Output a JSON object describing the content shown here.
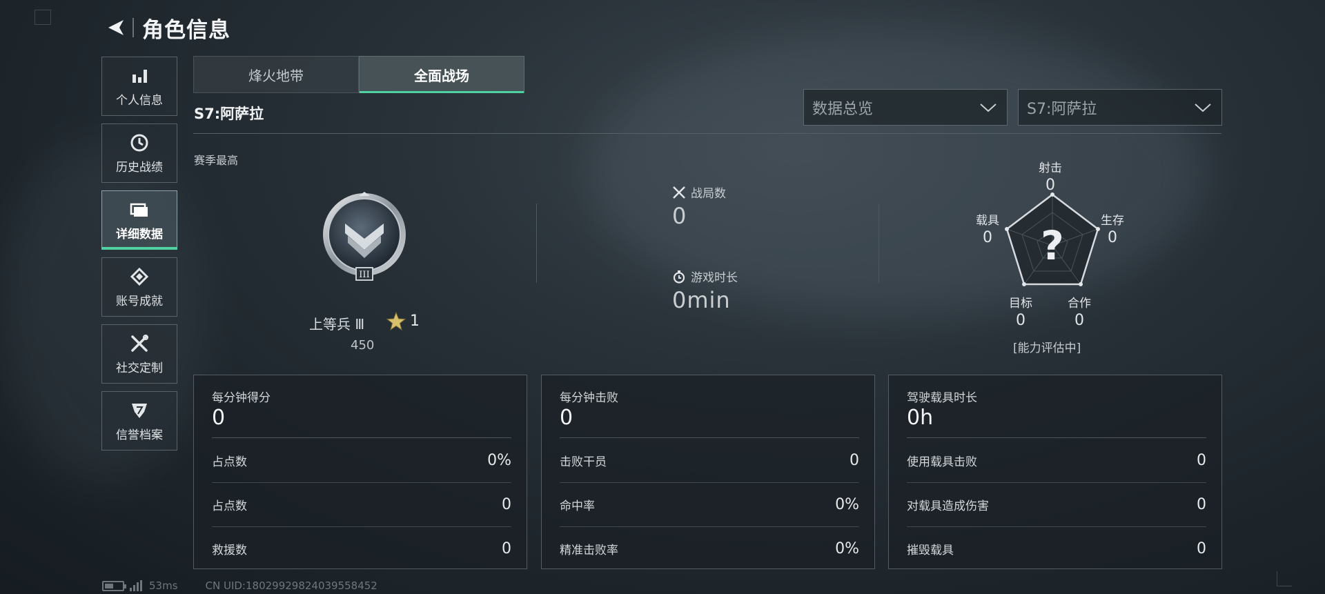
{
  "header": {
    "title": "角色信息"
  },
  "sidebar": {
    "items": [
      {
        "label": "个人信息",
        "icon": "bar-chart-icon"
      },
      {
        "label": "历史战绩",
        "icon": "clock-icon"
      },
      {
        "label": "详细数据",
        "icon": "folder-icon",
        "active": true
      },
      {
        "label": "账号成就",
        "icon": "achievement-icon"
      },
      {
        "label": "社交定制",
        "icon": "tools-icon"
      },
      {
        "label": "信誉档案",
        "icon": "shield-icon"
      }
    ]
  },
  "mode_tabs": [
    {
      "label": "烽火地带",
      "active": false
    },
    {
      "label": "全面战场",
      "active": true
    }
  ],
  "season_title": "S7:阿萨拉",
  "dropdowns": {
    "overview": {
      "value": "数据总览"
    },
    "season": {
      "value": "S7:阿萨拉"
    }
  },
  "season_best": {
    "label": "赛季最高",
    "rank_name": "上等兵 Ⅲ",
    "rank_numeral": "III",
    "stars": "1",
    "score": "450"
  },
  "stats": {
    "matches": {
      "label": "战局数",
      "value": "0"
    },
    "playtime": {
      "label": "游戏时长",
      "value": "0min"
    }
  },
  "radar": {
    "axes": [
      {
        "label": "射击",
        "value": "0"
      },
      {
        "label": "生存",
        "value": "0"
      },
      {
        "label": "合作",
        "value": "0"
      },
      {
        "label": "目标",
        "value": "0"
      },
      {
        "label": "载具",
        "value": "0"
      }
    ],
    "center_mark": "?",
    "status": "[能力评估中]"
  },
  "panels": [
    {
      "title": "每分钟得分",
      "value": "0",
      "rows": [
        {
          "label": "占点数",
          "value": "0%"
        },
        {
          "label": "占点数",
          "value": "0"
        },
        {
          "label": "救援数",
          "value": "0"
        }
      ]
    },
    {
      "title": "每分钟击败",
      "value": "0",
      "rows": [
        {
          "label": "击败干员",
          "value": "0"
        },
        {
          "label": "命中率",
          "value": "0%"
        },
        {
          "label": "精准击败率",
          "value": "0%"
        }
      ]
    },
    {
      "title": "驾驶载具时长",
      "value": "0h",
      "rows": [
        {
          "label": "使用载具击败",
          "value": "0"
        },
        {
          "label": "对载具造成伤害",
          "value": "0"
        },
        {
          "label": "摧毁载具",
          "value": "0"
        }
      ]
    }
  ],
  "footer": {
    "ping": "53ms",
    "uid": "CN UID:18029929824039558452"
  },
  "colors": {
    "accent": "#4fd1a1",
    "star": "#d9c06a"
  }
}
